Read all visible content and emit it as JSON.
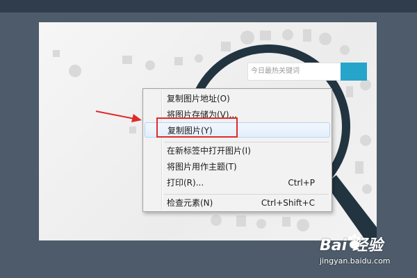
{
  "search": {
    "placeholder": "今日最热关键词"
  },
  "context_menu": {
    "items": [
      {
        "label": "复制图片地址(O)",
        "shortcut": ""
      },
      {
        "label": "将图片存储为(V)...",
        "shortcut": ""
      },
      {
        "label": "复制图片(Y)",
        "shortcut": "",
        "highlighted": true
      },
      {
        "label": "在新标签中打开图片(I)",
        "shortcut": ""
      },
      {
        "label": "将图片用作主题(T)",
        "shortcut": ""
      },
      {
        "label": "打印(R)...",
        "shortcut": "Ctrl+P"
      },
      {
        "label": "检查元素(N)",
        "shortcut": "Ctrl+Shift+C"
      }
    ]
  },
  "annotation": {
    "highlight_color": "#e02a2a"
  },
  "watermark": {
    "logo_text": "Bai  经验",
    "url": "jingyan.baidu.com"
  },
  "colors": {
    "accent": "#27a4c9",
    "background": "#4d5b6a"
  }
}
